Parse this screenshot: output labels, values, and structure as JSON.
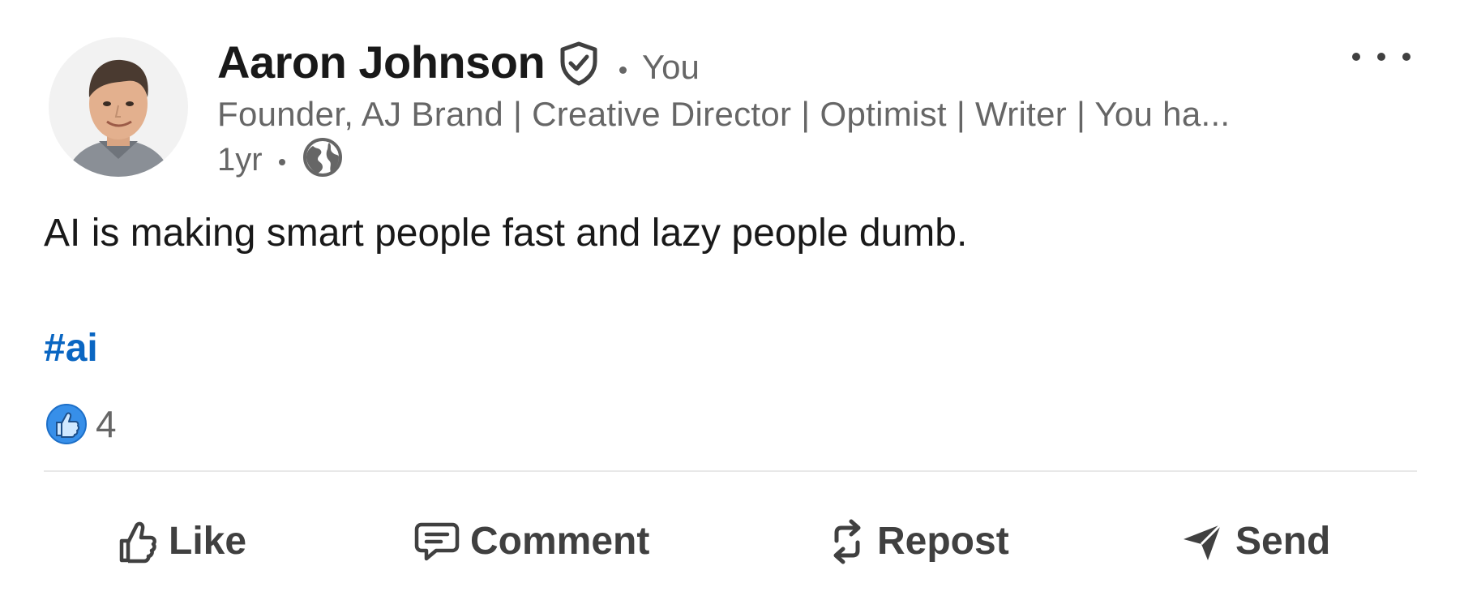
{
  "post": {
    "author": {
      "name": "Aaron Johnson",
      "degree": "You",
      "headline": "Founder, AJ Brand | Creative Director | Optimist | Writer | You ha...",
      "verified_icon": "verified-shield-icon",
      "avatar": "author-avatar-photo"
    },
    "meta": {
      "time": "1yr",
      "visibility_icon": "globe-icon"
    },
    "text": "AI is making smart people fast and lazy people dumb.",
    "hashtag": "#ai",
    "reactions": {
      "icon": "like-reaction-icon",
      "count": "4"
    },
    "more_menu_icon": "ellipsis-icon"
  },
  "actions": {
    "like": {
      "label": "Like",
      "icon": "thumbs-up-icon"
    },
    "comment": {
      "label": "Comment",
      "icon": "comment-bubble-icon"
    },
    "repost": {
      "label": "Repost",
      "icon": "repost-icon"
    },
    "send": {
      "label": "Send",
      "icon": "send-paper-plane-icon"
    }
  },
  "colors": {
    "text_primary": "#191919",
    "text_secondary": "#666666",
    "action_text": "#404040",
    "link_blue": "#0a66c2",
    "reaction_blue": "#378fe9",
    "divider": "#e8e8e8"
  }
}
